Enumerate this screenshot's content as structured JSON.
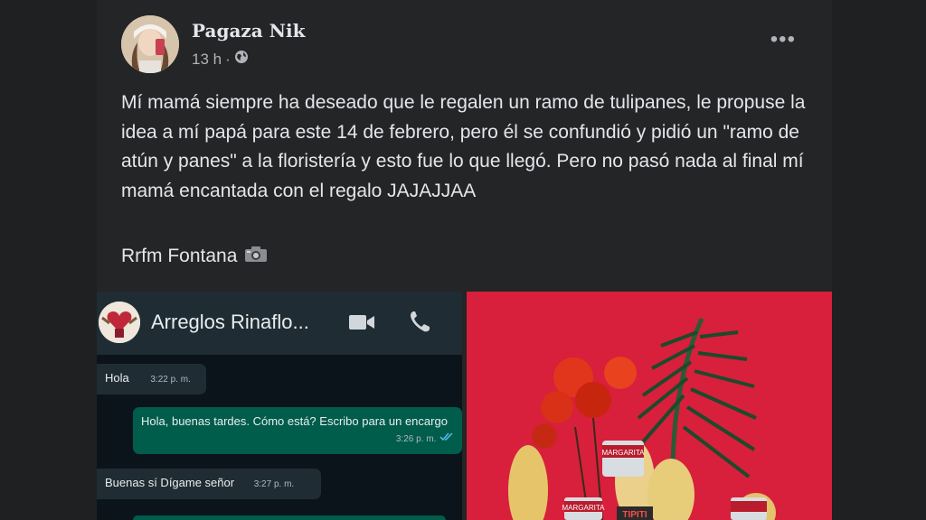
{
  "post": {
    "author": "Pagaza Nik",
    "time": "13 h",
    "separator": "·",
    "text": "Mí mamá siempre ha deseado que le regalen un ramo de tulipanes, le propuse la idea a mí papá para este 14 de febrero, pero él se confundió y pidió un \"ramo de atún y panes\" a la floristería y esto fue lo que llegó. Pero no pasó nada al final mí mamá encantada con el regalo JAJAJJAA",
    "credit": "Rrfm Fontana",
    "more_label": "•••"
  },
  "chat": {
    "contact": "Arreglos Rinaflo...",
    "messages": [
      {
        "text": "Hola",
        "time": "3:22 p. m."
      },
      {
        "text": "Hola, buenas tardes. Cómo está? Escribo para un encargo",
        "time": "3:26 p. m."
      },
      {
        "text": "Buenas sí Dígame señor",
        "time": "3:27 p. m."
      }
    ]
  },
  "photo": {
    "can_label_1": "MARGARITA",
    "can_label_2": "TIPITI",
    "can_label_3": "MARGARITA"
  },
  "colors": {
    "post_bg": "#242526",
    "text": "#e4e6eb",
    "secondary": "#b0b3b8",
    "chat_out": "#005c4b",
    "photo_bg": "#d81f3c"
  }
}
